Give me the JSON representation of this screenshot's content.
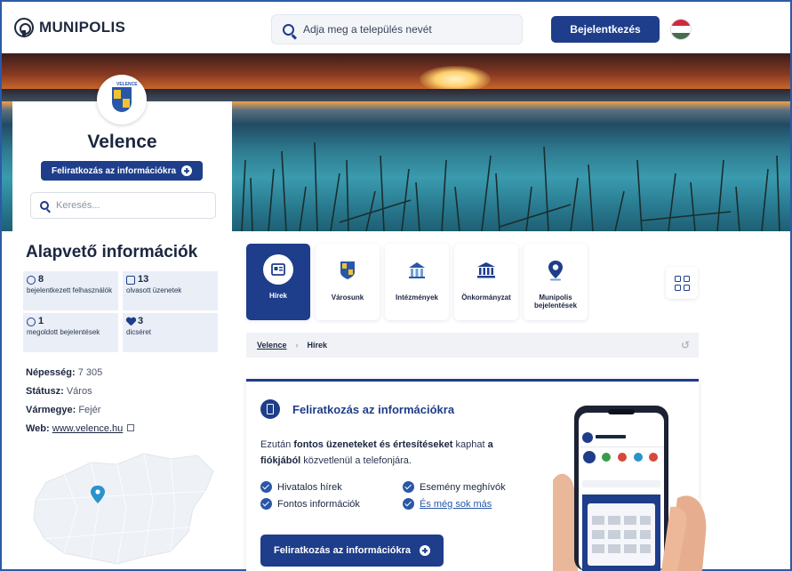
{
  "header": {
    "logo_text": "MUNIPOLIS",
    "search_placeholder": "Adja meg a település nevét",
    "login_label": "Bejelentkezés",
    "language_icon": "hungarian-flag-icon"
  },
  "town": {
    "name": "Velence",
    "crest_text": "VELENCE",
    "subscribe_label": "Feliratkozás az információkra",
    "search_placeholder": "Keresés..."
  },
  "basic_info": {
    "title": "Alapvető információk",
    "stats": [
      {
        "value": "8",
        "label": "bejelentkezett felhasználók",
        "icon": "user-icon"
      },
      {
        "value": "13",
        "label": "olvasott üzenetek",
        "icon": "message-icon"
      },
      {
        "value": "1",
        "label": "megoldott bejelentések",
        "icon": "person-icon"
      },
      {
        "value": "3",
        "label": "dicséret",
        "icon": "heart-icon"
      }
    ],
    "facts": {
      "population_label": "Népesség:",
      "population_value": "7 305",
      "status_label": "Státusz:",
      "status_value": "Város",
      "county_label": "Vármegye:",
      "county_value": "Fejér",
      "web_label": "Web:",
      "web_value": "www.velence.hu"
    }
  },
  "tiles": [
    {
      "label": "Hírek",
      "icon": "news-icon",
      "active": true
    },
    {
      "label": "Városunk",
      "icon": "crest-icon",
      "active": false
    },
    {
      "label": "Intézmények",
      "icon": "institution-icon",
      "active": false
    },
    {
      "label": "Önkormányzat",
      "icon": "government-icon",
      "active": false
    },
    {
      "label": "Munipolis bejelentések",
      "icon": "location-pin-icon",
      "active": false
    }
  ],
  "breadcrumb": {
    "home": "Velence",
    "current": "Hírek"
  },
  "subscribe_card": {
    "title": "Feliratkozás az információkra",
    "desc_1": "Ezután ",
    "desc_bold_1": "fontos üzeneteket és értesítéseket",
    "desc_2": " kaphat ",
    "desc_bold_2": "a fiókjából",
    "desc_3": " közvetlenül a telefonjára.",
    "features": [
      "Hivatalos hírek",
      "Esemény meghívók",
      "Fontos információk",
      "És még sok más"
    ],
    "button_label": "Feliratkozás az információkra"
  },
  "colors": {
    "primary": "#1e3d8a",
    "link": "#2957a8",
    "stat_bg": "#e9eef7"
  }
}
